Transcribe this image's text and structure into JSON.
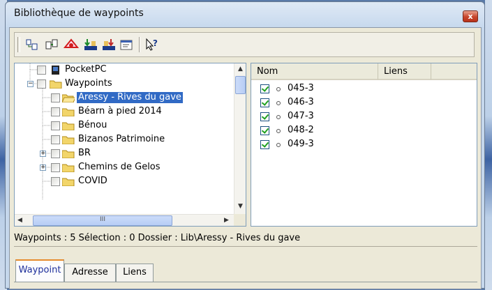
{
  "window": {
    "title": "Bibliothèque de waypoints",
    "close_label": "x"
  },
  "toolbar": {
    "buttons": [
      {
        "icon": "connect-icon"
      },
      {
        "icon": "new-folder-icon"
      },
      {
        "icon": "delete-icon"
      },
      {
        "icon": "import-icon"
      },
      {
        "icon": "export-icon"
      },
      {
        "icon": "properties-icon"
      },
      {
        "icon": "help-icon"
      }
    ]
  },
  "tree": {
    "items": [
      {
        "label": "PocketPC"
      },
      {
        "label": "Waypoints"
      },
      {
        "label": "Aressy - Rives du gave"
      },
      {
        "label": "Béarn à pied 2014"
      },
      {
        "label": "Bénou"
      },
      {
        "label": "Bizanos Patrimoine"
      },
      {
        "label": "BR"
      },
      {
        "label": "Chemins de Gelos"
      },
      {
        "label": "COVID"
      }
    ],
    "hscroll_grip": "III"
  },
  "list": {
    "columns": [
      "Nom",
      "Liens"
    ],
    "rows": [
      {
        "name": "045-3",
        "checked": true
      },
      {
        "name": "046-3",
        "checked": true
      },
      {
        "name": "047-3",
        "checked": true
      },
      {
        "name": "048-2",
        "checked": true
      },
      {
        "name": "049-3",
        "checked": true
      }
    ]
  },
  "status": {
    "text": "Waypoints : 5 Sélection : 0 Dossier : Lib\\Aressy - Rives du gave"
  },
  "tabs": [
    "Waypoint",
    "Adresse",
    "Liens"
  ],
  "colors": {
    "selection": "#316ac5",
    "active_tab_accent": "#e68b2c"
  }
}
